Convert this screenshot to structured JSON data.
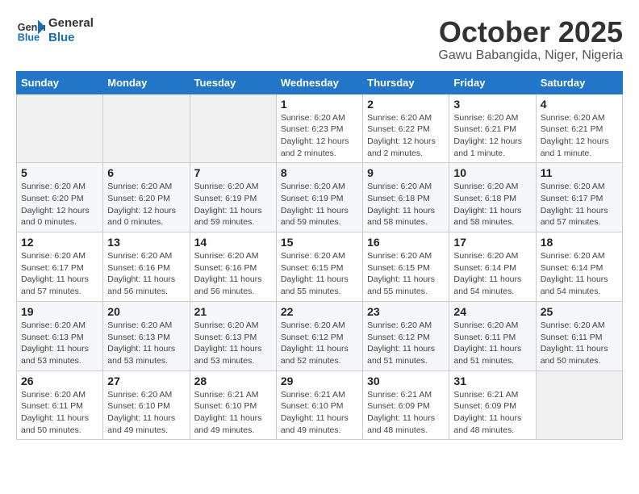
{
  "header": {
    "logo_line1": "General",
    "logo_line2": "Blue",
    "month": "October 2025",
    "location": "Gawu Babangida, Niger, Nigeria"
  },
  "weekdays": [
    "Sunday",
    "Monday",
    "Tuesday",
    "Wednesday",
    "Thursday",
    "Friday",
    "Saturday"
  ],
  "weeks": [
    [
      {
        "day": "",
        "info": ""
      },
      {
        "day": "",
        "info": ""
      },
      {
        "day": "",
        "info": ""
      },
      {
        "day": "1",
        "info": "Sunrise: 6:20 AM\nSunset: 6:23 PM\nDaylight: 12 hours\nand 2 minutes."
      },
      {
        "day": "2",
        "info": "Sunrise: 6:20 AM\nSunset: 6:22 PM\nDaylight: 12 hours\nand 2 minutes."
      },
      {
        "day": "3",
        "info": "Sunrise: 6:20 AM\nSunset: 6:21 PM\nDaylight: 12 hours\nand 1 minute."
      },
      {
        "day": "4",
        "info": "Sunrise: 6:20 AM\nSunset: 6:21 PM\nDaylight: 12 hours\nand 1 minute."
      }
    ],
    [
      {
        "day": "5",
        "info": "Sunrise: 6:20 AM\nSunset: 6:20 PM\nDaylight: 12 hours\nand 0 minutes."
      },
      {
        "day": "6",
        "info": "Sunrise: 6:20 AM\nSunset: 6:20 PM\nDaylight: 12 hours\nand 0 minutes."
      },
      {
        "day": "7",
        "info": "Sunrise: 6:20 AM\nSunset: 6:19 PM\nDaylight: 11 hours\nand 59 minutes."
      },
      {
        "day": "8",
        "info": "Sunrise: 6:20 AM\nSunset: 6:19 PM\nDaylight: 11 hours\nand 59 minutes."
      },
      {
        "day": "9",
        "info": "Sunrise: 6:20 AM\nSunset: 6:18 PM\nDaylight: 11 hours\nand 58 minutes."
      },
      {
        "day": "10",
        "info": "Sunrise: 6:20 AM\nSunset: 6:18 PM\nDaylight: 11 hours\nand 58 minutes."
      },
      {
        "day": "11",
        "info": "Sunrise: 6:20 AM\nSunset: 6:17 PM\nDaylight: 11 hours\nand 57 minutes."
      }
    ],
    [
      {
        "day": "12",
        "info": "Sunrise: 6:20 AM\nSunset: 6:17 PM\nDaylight: 11 hours\nand 57 minutes."
      },
      {
        "day": "13",
        "info": "Sunrise: 6:20 AM\nSunset: 6:16 PM\nDaylight: 11 hours\nand 56 minutes."
      },
      {
        "day": "14",
        "info": "Sunrise: 6:20 AM\nSunset: 6:16 PM\nDaylight: 11 hours\nand 56 minutes."
      },
      {
        "day": "15",
        "info": "Sunrise: 6:20 AM\nSunset: 6:15 PM\nDaylight: 11 hours\nand 55 minutes."
      },
      {
        "day": "16",
        "info": "Sunrise: 6:20 AM\nSunset: 6:15 PM\nDaylight: 11 hours\nand 55 minutes."
      },
      {
        "day": "17",
        "info": "Sunrise: 6:20 AM\nSunset: 6:14 PM\nDaylight: 11 hours\nand 54 minutes."
      },
      {
        "day": "18",
        "info": "Sunrise: 6:20 AM\nSunset: 6:14 PM\nDaylight: 11 hours\nand 54 minutes."
      }
    ],
    [
      {
        "day": "19",
        "info": "Sunrise: 6:20 AM\nSunset: 6:13 PM\nDaylight: 11 hours\nand 53 minutes."
      },
      {
        "day": "20",
        "info": "Sunrise: 6:20 AM\nSunset: 6:13 PM\nDaylight: 11 hours\nand 53 minutes."
      },
      {
        "day": "21",
        "info": "Sunrise: 6:20 AM\nSunset: 6:13 PM\nDaylight: 11 hours\nand 53 minutes."
      },
      {
        "day": "22",
        "info": "Sunrise: 6:20 AM\nSunset: 6:12 PM\nDaylight: 11 hours\nand 52 minutes."
      },
      {
        "day": "23",
        "info": "Sunrise: 6:20 AM\nSunset: 6:12 PM\nDaylight: 11 hours\nand 51 minutes."
      },
      {
        "day": "24",
        "info": "Sunrise: 6:20 AM\nSunset: 6:11 PM\nDaylight: 11 hours\nand 51 minutes."
      },
      {
        "day": "25",
        "info": "Sunrise: 6:20 AM\nSunset: 6:11 PM\nDaylight: 11 hours\nand 50 minutes."
      }
    ],
    [
      {
        "day": "26",
        "info": "Sunrise: 6:20 AM\nSunset: 6:11 PM\nDaylight: 11 hours\nand 50 minutes."
      },
      {
        "day": "27",
        "info": "Sunrise: 6:20 AM\nSunset: 6:10 PM\nDaylight: 11 hours\nand 49 minutes."
      },
      {
        "day": "28",
        "info": "Sunrise: 6:21 AM\nSunset: 6:10 PM\nDaylight: 11 hours\nand 49 minutes."
      },
      {
        "day": "29",
        "info": "Sunrise: 6:21 AM\nSunset: 6:10 PM\nDaylight: 11 hours\nand 49 minutes."
      },
      {
        "day": "30",
        "info": "Sunrise: 6:21 AM\nSunset: 6:09 PM\nDaylight: 11 hours\nand 48 minutes."
      },
      {
        "day": "31",
        "info": "Sunrise: 6:21 AM\nSunset: 6:09 PM\nDaylight: 11 hours\nand 48 minutes."
      },
      {
        "day": "",
        "info": ""
      }
    ]
  ]
}
